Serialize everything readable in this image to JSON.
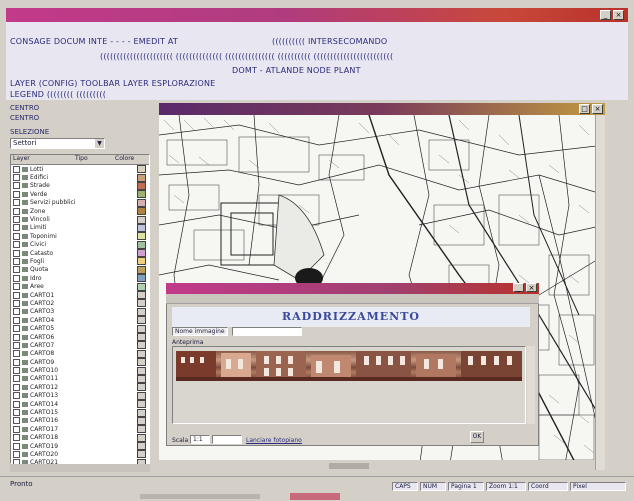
{
  "window": {
    "title": ""
  },
  "menu": {
    "row1_left": "CONSAGE DOCUM INTE - - - - EMEDIT AT",
    "row1_right": "(((((((((( INTERSECOMANDO",
    "row2": "(((((((((((((((((((((( (((((((((((((( ((((((((((((((( (((((((((( ((((((((((((((((((((((((",
    "row3": "DOMT - ATLANDE NODE PLANT",
    "row4_left": "LAYER (CONFIG) TOOLBAR LAYER ESPLORAZIONE",
    "row5_left": "LEGEND (((((((( ((((((((("
  },
  "left_panel": {
    "label1": "CENTRO",
    "label2": "CENTRO",
    "label3": "SELEZIONE",
    "dropdown_value": "Settori",
    "col_headers": [
      "Layer",
      "Tipo",
      "Colore"
    ],
    "layers": [
      {
        "name": "Lotti",
        "color": "#d9d4c0"
      },
      {
        "name": "Edifici",
        "color": "#c9a07a"
      },
      {
        "name": "Strade",
        "color": "#c07050"
      },
      {
        "name": "Verde",
        "color": "#a0b070"
      },
      {
        "name": "Servizi pubblici",
        "color": "#d6b0b0"
      },
      {
        "name": "Zone",
        "color": "#b08040"
      },
      {
        "name": "Vincoli",
        "color": "#d4d0c8"
      },
      {
        "name": "Limiti",
        "color": "#c0c0e0"
      },
      {
        "name": "Toponimi",
        "color": "#e0e0a0"
      },
      {
        "name": "Civici",
        "color": "#a0c0a0"
      },
      {
        "name": "Catasto",
        "color": "#d0a0d0"
      },
      {
        "name": "Fogli",
        "color": "#f0d080"
      },
      {
        "name": "Quota",
        "color": "#c0a060"
      },
      {
        "name": "Idro",
        "color": "#80a0c0"
      },
      {
        "name": "Aree",
        "color": "#b0d0b0"
      },
      {
        "name": "CARTO1",
        "color": "#d4d0c8"
      },
      {
        "name": "CARTO2",
        "color": "#d4d0c8"
      },
      {
        "name": "CARTO3",
        "color": "#d4d0c8"
      },
      {
        "name": "CARTO4",
        "color": "#d4d0c8"
      },
      {
        "name": "CARTO5",
        "color": "#d4d0c8"
      },
      {
        "name": "CARTO6",
        "color": "#d4d0c8"
      },
      {
        "name": "CARTO7",
        "color": "#d4d0c8"
      },
      {
        "name": "CARTO8",
        "color": "#d4d0c8"
      },
      {
        "name": "CARTO9",
        "color": "#d4d0c8"
      },
      {
        "name": "CARTO10",
        "color": "#d4d0c8"
      },
      {
        "name": "CARTO11",
        "color": "#d4d0c8"
      },
      {
        "name": "CARTO12",
        "color": "#d4d0c8"
      },
      {
        "name": "CARTO13",
        "color": "#d4d0c8"
      },
      {
        "name": "CARTO14",
        "color": "#d4d0c8"
      },
      {
        "name": "CARTO15",
        "color": "#d4d0c8"
      },
      {
        "name": "CARTO16",
        "color": "#d4d0c8"
      },
      {
        "name": "CARTO17",
        "color": "#d4d0c8"
      },
      {
        "name": "CARTO18",
        "color": "#d4d0c8"
      },
      {
        "name": "CARTO19",
        "color": "#d4d0c8"
      },
      {
        "name": "CARTO20",
        "color": "#d4d0c8"
      },
      {
        "name": "CARTO21",
        "color": "#d4d0c8"
      }
    ]
  },
  "dialog": {
    "heading": "RADDRIZZAMENTO",
    "label_file": "Nome immagine",
    "label_preview": "Anteprima",
    "footer_label": "Scala",
    "footer_value": "1:1",
    "footer_link": "Lanciare fotopiano",
    "ok_label": "OK"
  },
  "status": {
    "left": "Pronto",
    "items": [
      "CAPS",
      "NUM",
      "Pagina 1",
      "Zoom 1:1",
      "Coord",
      "Pixel"
    ]
  }
}
